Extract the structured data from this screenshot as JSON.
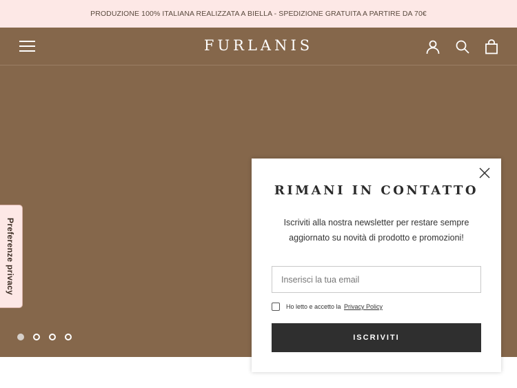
{
  "announcement": {
    "text": "PRODUZIONE 100% ITALIANA REALIZZATA A BIELLA - SPEDIZIONE GRATUITA A PARTIRE DA 70€"
  },
  "header": {
    "logo": "FURLANIS",
    "icons": [
      "hamburger-menu-icon",
      "account-icon",
      "search-icon",
      "shopping-bag-icon"
    ]
  },
  "hero": {
    "background_color": "#85674b",
    "slides_total": 4,
    "active_slide": 1
  },
  "privacy_tab": {
    "label": "Preferenze privacy"
  },
  "newsletter_popup": {
    "title": "RIMANI IN CONTATTO",
    "description": "Iscriviti alla nostra newsletter per restare sempre aggiornato su novità di prodotto e promozioni!",
    "email_placeholder": "Inserisci la tua email",
    "consent_prefix": "Ho letto e accetto la ",
    "consent_link": "Privacy Policy",
    "consent_checked": false,
    "submit_label": "ISCRIVITI"
  },
  "colors": {
    "announcement_bg": "#fde8e6",
    "brand_brown": "#85674b",
    "button_dark": "#2f2f2f"
  }
}
